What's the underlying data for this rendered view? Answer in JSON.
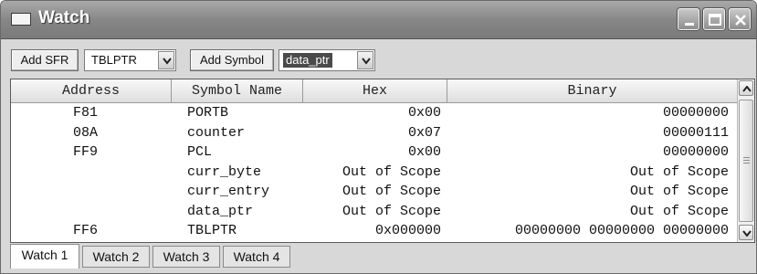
{
  "window": {
    "title": "Watch"
  },
  "toolbar": {
    "add_sfr_label": "Add SFR",
    "sfr_combo_value": "TBLPTR",
    "add_symbol_label": "Add Symbol",
    "symbol_combo_value": "data_ptr"
  },
  "table": {
    "columns": [
      "Address",
      "Symbol Name",
      "Hex",
      "Binary"
    ],
    "rows": [
      {
        "address": "F81",
        "symbol": "PORTB",
        "hex": "0x00",
        "binary": "00000000"
      },
      {
        "address": "08A",
        "symbol": "counter",
        "hex": "0x07",
        "binary": "00000111"
      },
      {
        "address": "FF9",
        "symbol": "PCL",
        "hex": "0x00",
        "binary": "00000000"
      },
      {
        "address": "",
        "symbol": "curr_byte",
        "hex": "Out of Scope",
        "binary": "Out of Scope"
      },
      {
        "address": "",
        "symbol": "curr_entry",
        "hex": "Out of Scope",
        "binary": "Out of Scope"
      },
      {
        "address": "",
        "symbol": "data_ptr",
        "hex": "Out of Scope",
        "binary": "Out of Scope"
      },
      {
        "address": "FF6",
        "symbol": "TBLPTR",
        "hex": "0x000000",
        "binary": "00000000 00000000 00000000"
      }
    ]
  },
  "tabs": [
    "Watch 1",
    "Watch 2",
    "Watch 3",
    "Watch 4"
  ],
  "active_tab": "Watch 1",
  "colors": {
    "titlebar": "#878787",
    "selection": "#4a4a4a",
    "grid_bg": "#ffffff"
  },
  "icons": [
    "window-icon",
    "minimize-icon",
    "maximize-icon",
    "close-icon",
    "dropdown-arrow-icon",
    "scroll-up-icon",
    "scroll-down-icon"
  ]
}
